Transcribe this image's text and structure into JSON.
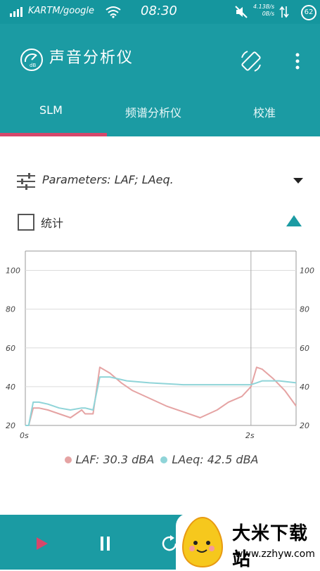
{
  "status_bar": {
    "carrier": "KARTM/google",
    "time": "08:30",
    "speed_line1": "4.13B/s",
    "speed_line2": "0B/s",
    "battery": "62"
  },
  "app_bar": {
    "title": "声音分析仪",
    "tabs": [
      {
        "label": "SLM",
        "selected": true
      },
      {
        "label": "频谱分析仪",
        "selected": false
      },
      {
        "label": "校准",
        "selected": false
      }
    ]
  },
  "params": {
    "label": "Parameters: LAF; LAeq."
  },
  "stats": {
    "label": "统计",
    "checked": false
  },
  "chart_data": {
    "type": "line",
    "ylim": [
      20,
      110
    ],
    "xlim": [
      0,
      2.4
    ],
    "y_ticks": [
      "100",
      "80",
      "60",
      "40",
      "20"
    ],
    "x_ticks": [
      "0s",
      "2s"
    ],
    "marker_x": 2,
    "grid": true,
    "series": [
      {
        "name": "LAF",
        "color": "#e5a3a3",
        "x": [
          0,
          0.03,
          0.07,
          0.12,
          0.2,
          0.3,
          0.4,
          0.5,
          0.53,
          0.6,
          0.66,
          0.75,
          0.85,
          0.95,
          1.1,
          1.25,
          1.4,
          1.55,
          1.7,
          1.8,
          1.92,
          2.0,
          2.05,
          2.1,
          2.2,
          2.3,
          2.4
        ],
        "y": [
          20,
          20,
          29,
          29,
          28,
          26,
          24,
          28,
          26,
          26,
          50,
          47,
          42,
          38,
          34,
          30,
          27,
          24,
          28,
          32,
          35,
          40,
          50,
          49,
          44,
          38,
          30
        ]
      },
      {
        "name": "LAeq",
        "color": "#8fd4d8",
        "x": [
          0,
          0.03,
          0.07,
          0.12,
          0.2,
          0.3,
          0.4,
          0.5,
          0.53,
          0.6,
          0.66,
          0.75,
          0.9,
          1.1,
          1.4,
          1.7,
          1.9,
          2.0,
          2.05,
          2.1,
          2.25,
          2.4
        ],
        "y": [
          20,
          20,
          32,
          32,
          31,
          29,
          28,
          29,
          29,
          28,
          45,
          45,
          43,
          42,
          41,
          41,
          41,
          41,
          42,
          43,
          43,
          42
        ]
      }
    ]
  },
  "legend": {
    "laf_label": "LAF: 30.3 dBA",
    "laeq_label": "LAeq: 42.5 dBA"
  },
  "colors": {
    "teal": "#1b9ba3",
    "status_teal": "#15969e",
    "accent_pink": "#d6476b"
  },
  "watermark": {
    "name": "大米下载站",
    "url": "www.zzhyw.com"
  }
}
